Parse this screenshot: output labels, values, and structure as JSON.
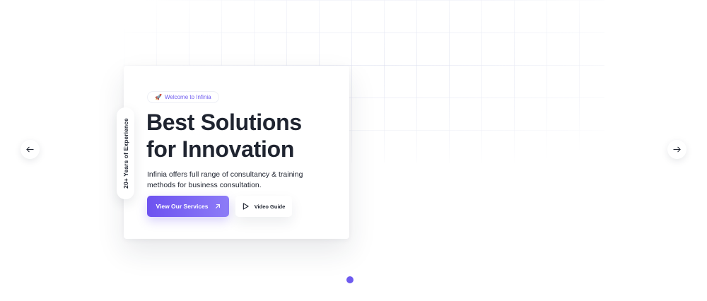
{
  "hero": {
    "badge_icon": "rocket-icon",
    "badge_text": "Welcome to Infinia",
    "experience_text": "20+ Years of Experience",
    "headline_line1": "Best Solutions",
    "headline_line2": "for Innovation",
    "description": "Infinia offers full range of consultancy & training methods for business consultation.",
    "primary_button": {
      "label": "View Our Services",
      "icon": "arrow-up-right-icon"
    },
    "video_button": {
      "label": "Video Guide",
      "icon": "play-icon"
    }
  },
  "carousel": {
    "prev_icon": "arrow-left-icon",
    "next_icon": "arrow-right-icon",
    "slide_count": 1,
    "active_slide": 1
  },
  "colors": {
    "accent": "#6e5bef",
    "accent_gradient_start": "#6d52f0",
    "accent_gradient_end": "#8d7cf7",
    "text_dark": "#1f2430",
    "background": "#ffffff"
  }
}
